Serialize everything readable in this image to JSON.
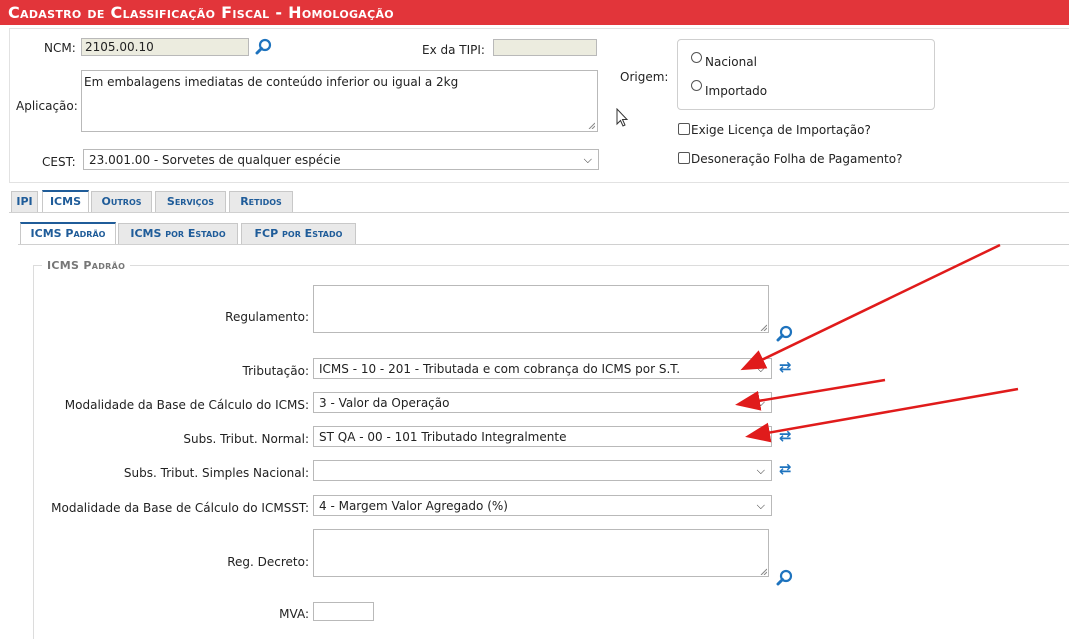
{
  "title": "Cadastro de Classificação Fiscal  - Homologação",
  "header": {
    "ncm_label": "NCM:",
    "ncm_value": "2105.00.10",
    "ex_tipi_label": "Ex da TIPI:",
    "ex_tipi_value": "",
    "aplicacao_label": "Aplicação:",
    "aplicacao_value": "Em embalagens imediatas de conteúdo inferior ou igual a 2kg",
    "cest_label": "CEST:",
    "cest_value": "23.001.00 - Sorvetes de qualquer espécie",
    "origem_label": "Origem:",
    "origem_options": [
      "Nacional",
      "Importado"
    ],
    "checkbox_licenca": "Exige Licença de Importação?",
    "checkbox_desoneracao": "Desoneração Folha de Pagamento?"
  },
  "tabs": [
    "IPI",
    "ICMS",
    "Outros",
    "Serviços",
    "Retidos"
  ],
  "active_tab": "ICMS",
  "subtabs": [
    "ICMS Padrão",
    "ICMS por Estado",
    "FCP por Estado"
  ],
  "active_subtab": "ICMS Padrão",
  "section": {
    "legend": "ICMS Padrão",
    "regulamento_label": "Regulamento:",
    "regulamento_value": "",
    "tributacao_label": "Tributação:",
    "tributacao_value": "ICMS - 10 - 201 - Tributada e com cobrança do ICMS por S.T.",
    "modalidade_icms_label": "Modalidade da Base de Cálculo do ICMS:",
    "modalidade_icms_value": "3 - Valor da Operação",
    "subs_normal_label": "Subs. Tribut. Normal:",
    "subs_normal_value": "ST QA - 00 - 101 Tributado Integralmente",
    "subs_simples_label": "Subs. Tribut. Simples Nacional:",
    "subs_simples_value": "",
    "modalidade_icmsst_label": "Modalidade da Base de Cálculo do ICMSST:",
    "modalidade_icmsst_value": "4 - Margem Valor Agregado (%)",
    "reg_decreto_label": "Reg. Decreto:",
    "reg_decreto_value": "",
    "mva_label": "MVA:",
    "mva_value": ""
  },
  "icons": {
    "search": "magnifier-icon",
    "refresh": "refresh-icon",
    "select": "chevron-down-icon"
  },
  "colors": {
    "titlebar": "#e2353a",
    "tab_text": "#1f5c99",
    "annotation_arrow": "#e01b1b"
  }
}
